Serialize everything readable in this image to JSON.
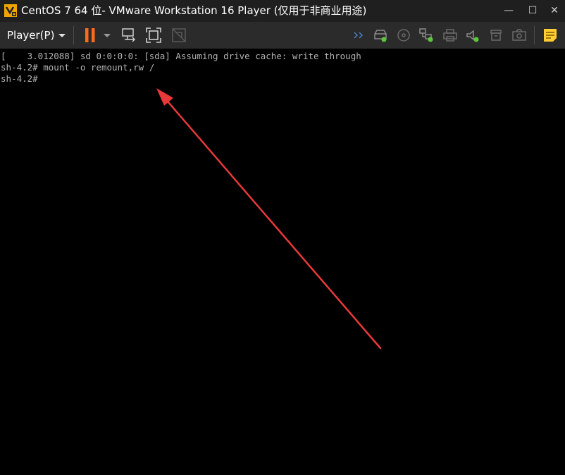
{
  "window": {
    "title": "CentOS 7 64 位- VMware Workstation 16 Player (仅用于非商业用途)",
    "minimize_glyph": "—",
    "maximize_glyph": "☐",
    "close_glyph": "✕"
  },
  "toolbar": {
    "player_menu_label": "Player(P)",
    "icons": [
      "pause-icon",
      "dropdown-caret-icon",
      "send-ctrl-alt-del-icon",
      "fullscreen-icon",
      "unity-icon",
      "forward-icon",
      "hard-disk-icon",
      "cd-dvd-icon",
      "network-icon",
      "printer-icon",
      "sound-icon",
      "usb-icon",
      "camera-icon",
      "message-icon"
    ],
    "accent_color": "#ff6a1a",
    "device_active_color": "#5ac83a"
  },
  "console": {
    "lines": [
      "[    3.012088] sd 0:0:0:0: [sda] Assuming drive cache: write through",
      "sh-4.2# mount -o remount,rw /",
      "sh-4.2#"
    ],
    "annotation_color": "#e8393a"
  }
}
